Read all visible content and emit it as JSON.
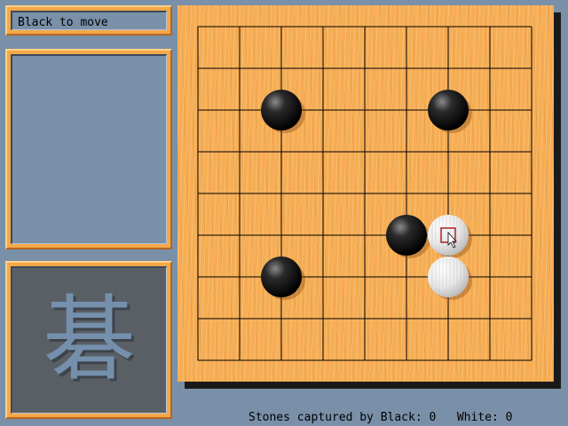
{
  "status": {
    "text": "Black to move"
  },
  "log": {
    "lines": []
  },
  "logo": {
    "character": "碁"
  },
  "board": {
    "columns": 9,
    "rows": 9,
    "stones": [
      {
        "color": "black",
        "col": 2,
        "row": 2
      },
      {
        "color": "black",
        "col": 6,
        "row": 2
      },
      {
        "color": "black",
        "col": 5,
        "row": 5
      },
      {
        "color": "black",
        "col": 2,
        "row": 6
      },
      {
        "color": "white",
        "col": 6,
        "row": 5
      },
      {
        "color": "white",
        "col": 6,
        "row": 6
      }
    ],
    "cursor": {
      "col": 6,
      "row": 5
    },
    "colors": {
      "wood": "#f6ad55",
      "line": "#000000",
      "cursor": "#b02030"
    }
  },
  "footer": {
    "black_label": "Stones captured by Black:",
    "black_count": "0",
    "white_label": "White:",
    "white_count": "0"
  }
}
